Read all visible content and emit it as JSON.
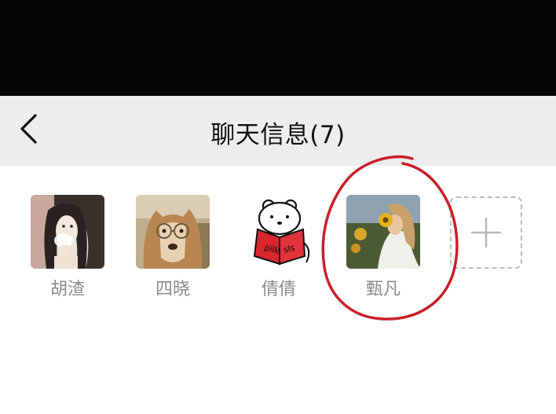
{
  "header": {
    "title": "聊天信息(7)",
    "back_icon": "chevron-left-icon"
  },
  "members": [
    {
      "name": "胡渣",
      "avatar": "sketch-girl-avatar"
    },
    {
      "name": "四晓",
      "avatar": "dog-with-glasses-avatar"
    },
    {
      "name": "倩倩",
      "avatar": "bear-reading-book-avatar"
    },
    {
      "name": "甄凡",
      "avatar": "girl-with-sunflower-avatar"
    }
  ],
  "add_member": {
    "icon": "plus-icon"
  },
  "annotation": {
    "color": "#c8202a",
    "shape": "hand-drawn-circle"
  },
  "colors": {
    "nav_background": "#ededed",
    "name_text": "#8c8c8c",
    "top_band": "#050505"
  }
}
